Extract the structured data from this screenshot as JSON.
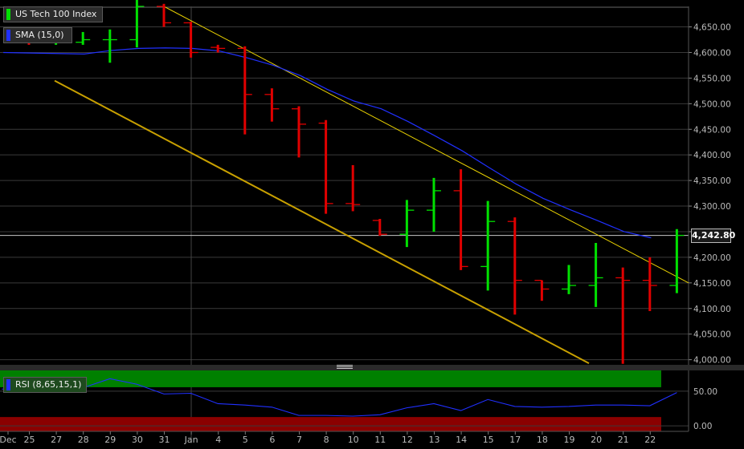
{
  "chart_data": [
    {
      "type": "candlestick",
      "title": "US Tech 100 Index",
      "indicator": "SMA (15,0)",
      "y_ticks": [
        4000,
        4050,
        4100,
        4150,
        4200,
        4250,
        4300,
        4350,
        4400,
        4450,
        4500,
        4550,
        4600,
        4650
      ],
      "y_tick_labels": [
        "4,000.00",
        "4,050.00",
        "4,100.00",
        "4,150.00",
        "4,200.00",
        "4,250.00",
        "4,300.00",
        "4,350.00",
        "4,400.00",
        "4,450.00",
        "4,500.00",
        "4,550.00",
        "4,600.00",
        "4,650.00"
      ],
      "ylim": [
        3990,
        4690
      ],
      "last_price": 4242.8,
      "last_price_label": "4,242.80",
      "x_labels": [
        "Dec",
        "25",
        "27",
        "28",
        "29",
        "30",
        "31",
        "Jan",
        "4",
        "5",
        "6",
        "7",
        "8",
        "10",
        "11",
        "12",
        "13",
        "14",
        "15",
        "17",
        "18",
        "19",
        "20",
        "21",
        "22"
      ],
      "bars": [
        {
          "open": 4630,
          "high": 4640,
          "low": 4615,
          "close": 4620
        },
        {
          "open": 4625,
          "high": 4635,
          "low": 4615,
          "close": 4625
        },
        {
          "open": 4620,
          "high": 4640,
          "low": 4615,
          "close": 4625
        },
        {
          "open": 4625,
          "high": 4645,
          "low": 4580,
          "close": 4625
        },
        {
          "open": 4625,
          "high": 4720,
          "low": 4610,
          "close": 4690
        },
        {
          "open": 4690,
          "high": 4695,
          "low": 4650,
          "close": 4658
        },
        {
          "open": 4658,
          "high": 4660,
          "low": 4590,
          "close": 4600
        },
        {
          "open": 4610,
          "high": 4615,
          "low": 4600,
          "close": 4608
        },
        {
          "open": 4608,
          "high": 4612,
          "low": 4440,
          "close": 4518
        },
        {
          "open": 4518,
          "high": 4530,
          "low": 4465,
          "close": 4490
        },
        {
          "open": 4490,
          "high": 4495,
          "low": 4395,
          "close": 4460
        },
        {
          "open": 4462,
          "high": 4468,
          "low": 4285,
          "close": 4305
        },
        {
          "open": 4305,
          "high": 4380,
          "low": 4290,
          "close": 4303
        },
        {
          "open": 4272,
          "high": 4275,
          "low": 4242,
          "close": 4245
        },
        {
          "open": 4245,
          "high": 4312,
          "low": 4220,
          "close": 4292
        },
        {
          "open": 4292,
          "high": 4355,
          "low": 4250,
          "close": 4330
        },
        {
          "open": 4330,
          "high": 4372,
          "low": 4175,
          "close": 4182
        },
        {
          "open": 4182,
          "high": 4310,
          "low": 4135,
          "close": 4270
        },
        {
          "open": 4270,
          "high": 4278,
          "low": 4088,
          "close": 4155
        },
        {
          "open": 4155,
          "high": 4155,
          "low": 4115,
          "close": 4138
        },
        {
          "open": 4138,
          "high": 4185,
          "low": 4128,
          "close": 4145
        },
        {
          "open": 4145,
          "high": 4228,
          "low": 4103,
          "close": 4160
        },
        {
          "open": 4160,
          "high": 4180,
          "low": 3992,
          "close": 4155
        },
        {
          "open": 4155,
          "high": 4200,
          "low": 4095,
          "close": 4145
        },
        {
          "open": 4145,
          "high": 4255,
          "low": 4130,
          "close": 4242.8
        }
      ],
      "sma": [
        4600,
        4599,
        4598,
        4597,
        4604,
        4608,
        4609,
        4608,
        4603,
        4590,
        4575,
        4555,
        4528,
        4505,
        4490,
        4465,
        4437,
        4408,
        4375,
        4343,
        4315,
        4293,
        4272,
        4250,
        4238
      ],
      "colors": {
        "up": "#00e000",
        "down": "#e00000",
        "sma": "#2030ff",
        "trend_upper": "#e8d000",
        "trend_lower": "#c8a000"
      }
    },
    {
      "type": "line",
      "title": "RSI (8,65,15,1)",
      "y_ticks": [
        0,
        50
      ],
      "y_tick_labels": [
        "0.00",
        "50.00"
      ],
      "ylim": [
        -8,
        80
      ],
      "overbought": 65,
      "oversold": 15,
      "values": [
        53,
        54,
        54,
        55,
        68,
        60,
        46,
        47,
        32,
        30,
        27,
        15,
        15,
        14,
        16,
        26,
        32,
        22,
        38,
        28,
        27,
        28,
        30,
        30,
        29,
        48
      ],
      "colors": {
        "line": "#2030ff",
        "overbought": "#008000",
        "oversold": "#8b0000"
      }
    }
  ]
}
